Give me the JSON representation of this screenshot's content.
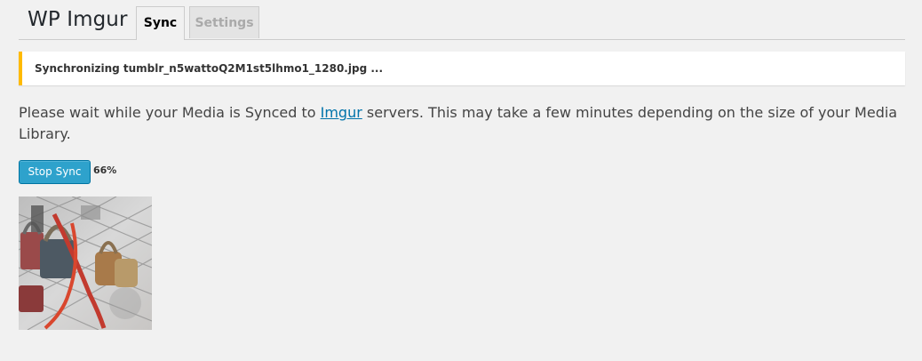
{
  "header": {
    "title": "WP Imgur",
    "tabs": [
      {
        "label": "Sync",
        "active": true
      },
      {
        "label": "Settings",
        "active": false
      }
    ]
  },
  "notice": {
    "text": "Synchronizing tumblr_n5wattoQ2M1st5lhmo1_1280.jpg ...",
    "accent_color": "#ffba00"
  },
  "message": {
    "before": "Please wait while your Media is Synced to ",
    "link": "Imgur",
    "after": " servers. This may take a few minutes depending on the size of your Media Library."
  },
  "controls": {
    "stop_label": "Stop Sync",
    "progress": "66%",
    "button_color": "#2ea2cc"
  },
  "media": {
    "thumbnail_description_icon": "padlocks-photo"
  }
}
